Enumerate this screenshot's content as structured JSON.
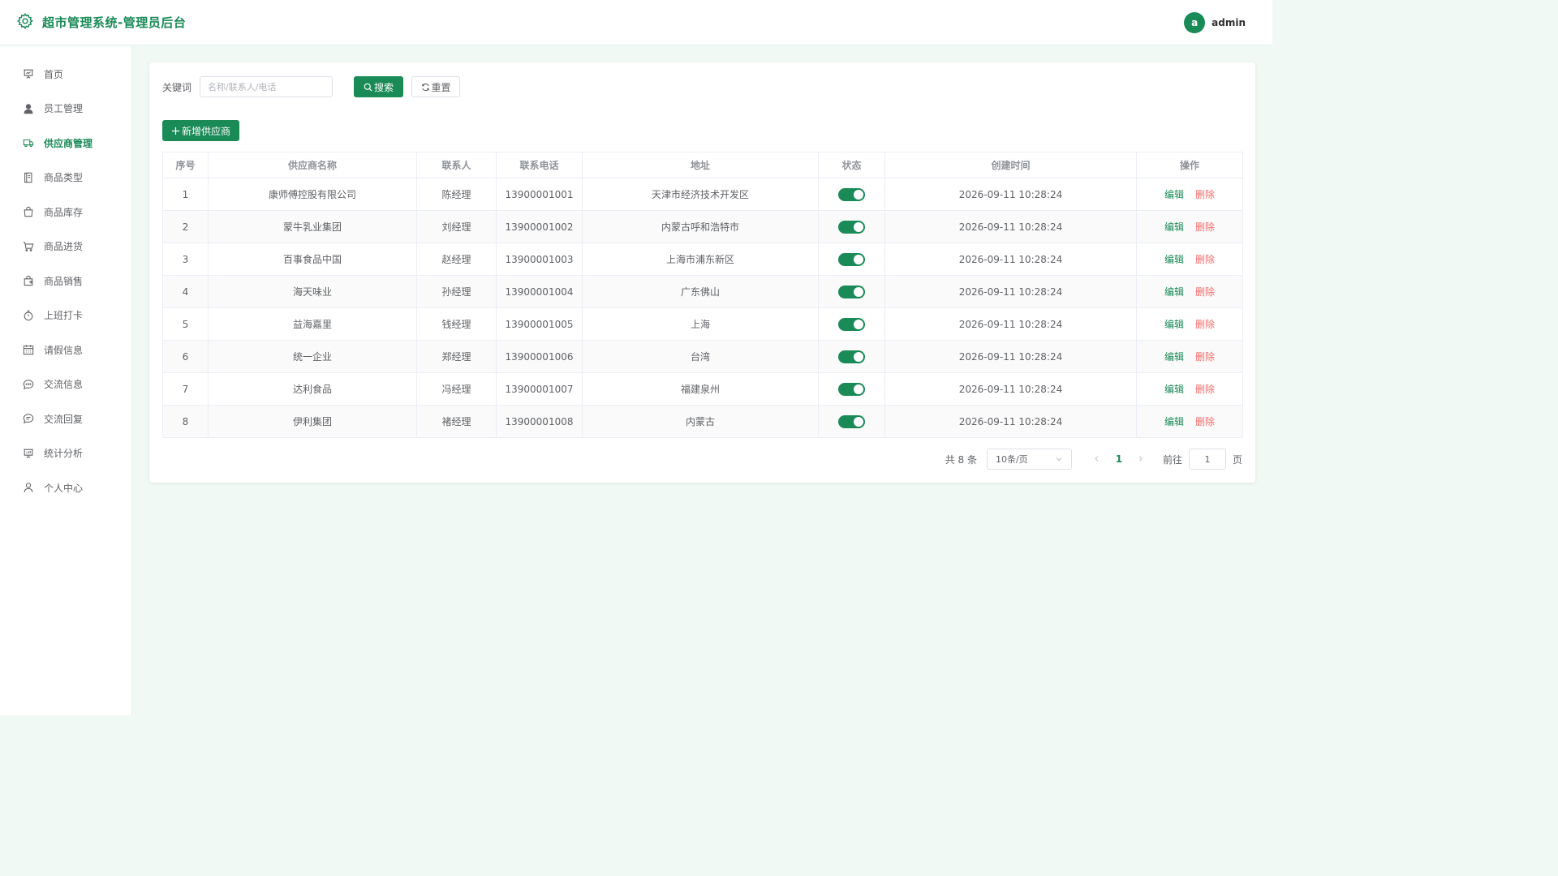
{
  "header": {
    "title": "超市管理系统-管理员后台",
    "avatar_letter": "a",
    "username": "admin"
  },
  "sidebar": {
    "items": [
      {
        "label": "首页",
        "icon": "presentation-icon"
      },
      {
        "label": "员工管理",
        "icon": "user-filled-icon"
      },
      {
        "label": "供应商管理",
        "icon": "truck-icon",
        "active": true
      },
      {
        "label": "商品类型",
        "icon": "notebook-icon"
      },
      {
        "label": "商品库存",
        "icon": "shopping-bag-icon"
      },
      {
        "label": "商品进货",
        "icon": "shopping-cart-icon"
      },
      {
        "label": "商品销售",
        "icon": "sold-out-icon"
      },
      {
        "label": "上班打卡",
        "icon": "stopwatch-icon"
      },
      {
        "label": "请假信息",
        "icon": "calendar-icon"
      },
      {
        "label": "交流信息",
        "icon": "chat-dots-icon"
      },
      {
        "label": "交流回复",
        "icon": "chat-lines-icon"
      },
      {
        "label": "统计分析",
        "icon": "data-board-icon"
      },
      {
        "label": "个人中心",
        "icon": "user-icon"
      }
    ]
  },
  "search": {
    "label": "关键词",
    "placeholder": "名称/联系人/电话",
    "search_label": "搜索",
    "reset_label": "重置"
  },
  "add_label": "新增供应商",
  "table": {
    "headers": [
      "序号",
      "供应商名称",
      "联系人",
      "联系电话",
      "地址",
      "状态",
      "创建时间",
      "操作"
    ],
    "edit_label": "编辑",
    "delete_label": "删除",
    "rows": [
      {
        "no": "1",
        "name": "康师傅控股有限公司",
        "contact": "陈经理",
        "phone": "13900001001",
        "address": "天津市经济技术开发区",
        "enabled": true,
        "created": "2026-09-11 10:28:24"
      },
      {
        "no": "2",
        "name": "蒙牛乳业集团",
        "contact": "刘经理",
        "phone": "13900001002",
        "address": "内蒙古呼和浩特市",
        "enabled": true,
        "created": "2026-09-11 10:28:24"
      },
      {
        "no": "3",
        "name": "百事食品中国",
        "contact": "赵经理",
        "phone": "13900001003",
        "address": "上海市浦东新区",
        "enabled": true,
        "created": "2026-09-11 10:28:24"
      },
      {
        "no": "4",
        "name": "海天味业",
        "contact": "孙经理",
        "phone": "13900001004",
        "address": "广东佛山",
        "enabled": true,
        "created": "2026-09-11 10:28:24"
      },
      {
        "no": "5",
        "name": "益海嘉里",
        "contact": "钱经理",
        "phone": "13900001005",
        "address": "上海",
        "enabled": true,
        "created": "2026-09-11 10:28:24"
      },
      {
        "no": "6",
        "name": "统一企业",
        "contact": "郑经理",
        "phone": "13900001006",
        "address": "台湾",
        "enabled": true,
        "created": "2026-09-11 10:28:24"
      },
      {
        "no": "7",
        "name": "达利食品",
        "contact": "冯经理",
        "phone": "13900001007",
        "address": "福建泉州",
        "enabled": true,
        "created": "2026-09-11 10:28:24"
      },
      {
        "no": "8",
        "name": "伊利集团",
        "contact": "褚经理",
        "phone": "13900001008",
        "address": "内蒙古",
        "enabled": true,
        "created": "2026-09-11 10:28:24"
      }
    ]
  },
  "pagination": {
    "total_text": "共 8 条",
    "page_size": "10条/页",
    "current_page": "1",
    "goto_label": "前往",
    "goto_value": "1",
    "goto_unit": "页"
  },
  "colors": {
    "primary": "#1a8a57",
    "danger": "#f56c6c",
    "background": "#f0f9f4"
  }
}
